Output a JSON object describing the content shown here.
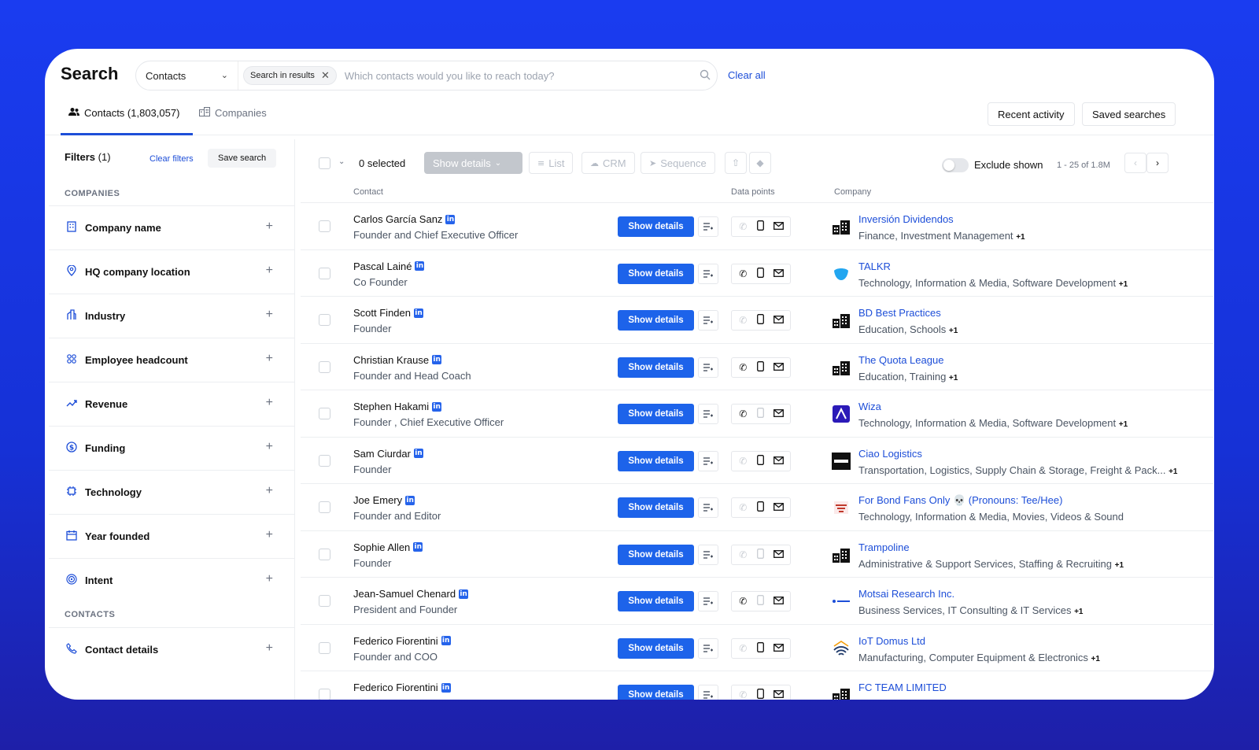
{
  "header": {
    "title": "Search",
    "scope": "Contacts",
    "chip": "Search in results",
    "search_placeholder": "Which contacts would you like to reach today?",
    "clear_all": "Clear all"
  },
  "tabs": {
    "contacts": "Contacts (1,803,057)",
    "companies": "Companies",
    "recent_activity": "Recent activity",
    "saved_searches": "Saved searches"
  },
  "sidebar": {
    "filters_label": "Filters",
    "filters_count": "(1)",
    "clear_filters": "Clear filters",
    "save_search": "Save search",
    "section_companies": "COMPANIES",
    "section_contacts": "CONTACTS",
    "company_filters": [
      {
        "label": "Company name",
        "icon": "building-icon"
      },
      {
        "label": "HQ company location",
        "icon": "location-pin-icon"
      },
      {
        "label": "Industry",
        "icon": "industry-icon"
      },
      {
        "label": "Employee headcount",
        "icon": "people-icon"
      },
      {
        "label": "Revenue",
        "icon": "trend-up-icon"
      },
      {
        "label": "Funding",
        "icon": "dollar-icon"
      },
      {
        "label": "Technology",
        "icon": "chip-icon"
      },
      {
        "label": "Year founded",
        "icon": "calendar-icon"
      },
      {
        "label": "Intent",
        "icon": "target-icon"
      }
    ],
    "contact_filters": [
      {
        "label": "Contact details",
        "icon": "phone-icon"
      }
    ]
  },
  "toolbar": {
    "selected": "0 selected",
    "show_details": "Show details",
    "list": "List",
    "crm": "CRM",
    "sequence": "Sequence",
    "exclude_shown": "Exclude shown",
    "exclude_shown_on": false,
    "pagination": "1 - 25 of 1.8M"
  },
  "columns": {
    "contact": "Contact",
    "data_points": "Data points",
    "company": "Company"
  },
  "show_details_label": "Show details",
  "rows": [
    {
      "name": "Carlos García Sanz",
      "title": "Founder and Chief Executive Officer",
      "company": "Inversión Dividendos",
      "industry": "Finance, Investment Management",
      "more": "+1",
      "phone": "off",
      "mobile": "on",
      "email": "on",
      "logo": "building"
    },
    {
      "name": "Pascal Lainé",
      "title": "Co Founder",
      "company": "TALKR",
      "industry": "Technology, Information & Media, Software Development",
      "more": "+1",
      "phone": "on",
      "mobile": "on",
      "email": "on",
      "logo": "talkr"
    },
    {
      "name": "Scott Finden",
      "title": "Founder",
      "company": "BD Best Practices",
      "industry": "Education, Schools",
      "more": "+1",
      "phone": "off",
      "mobile": "on",
      "email": "on",
      "logo": "building"
    },
    {
      "name": "Christian Krause",
      "title": "Founder and Head Coach",
      "company": "The Quota League",
      "industry": "Education, Training",
      "more": "+1",
      "phone": "on",
      "mobile": "on",
      "email": "on",
      "logo": "building"
    },
    {
      "name": "Stephen Hakami",
      "title": "Founder , Chief Executive Officer",
      "company": "Wiza",
      "industry": "Technology, Information & Media, Software Development",
      "more": "+1",
      "phone": "on",
      "mobile": "off",
      "email": "on",
      "logo": "wiza"
    },
    {
      "name": "Sam Ciurdar",
      "title": "Founder",
      "company": "Ciao Logistics",
      "industry": "Transportation, Logistics, Supply Chain & Storage, Freight & Pack...",
      "more": "+1",
      "phone": "off",
      "mobile": "on",
      "email": "on",
      "logo": "ciao"
    },
    {
      "name": "Joe Emery",
      "title": "Founder and Editor",
      "company": "For Bond Fans Only 💀 (Pronouns: Tee/Hee)",
      "industry": "Technology, Information & Media, Movies, Videos & Sound",
      "more": "",
      "phone": "off",
      "mobile": "on",
      "email": "on",
      "logo": "bond"
    },
    {
      "name": "Sophie Allen",
      "title": "Founder",
      "company": "Trampoline",
      "industry": "Administrative & Support Services, Staffing & Recruiting",
      "more": "+1",
      "phone": "off",
      "mobile": "off",
      "email": "on",
      "logo": "building"
    },
    {
      "name": "Jean-Samuel Chenard",
      "title": "President and Founder",
      "company": "Motsai Research Inc.",
      "industry": "Business Services, IT Consulting & IT Services",
      "more": "+1",
      "phone": "on",
      "mobile": "off",
      "email": "on",
      "logo": "motsai"
    },
    {
      "name": "Federico Fiorentini",
      "title": "Founder and COO",
      "company": "IoT Domus Ltd",
      "industry": "Manufacturing, Computer Equipment & Electronics",
      "more": "+1",
      "phone": "off",
      "mobile": "on",
      "email": "on",
      "logo": "iot"
    },
    {
      "name": "Federico Fiorentini",
      "title": "",
      "company": "FC TEAM LIMITED",
      "industry": "",
      "more": "",
      "phone": "off",
      "mobile": "on",
      "email": "on",
      "logo": "building"
    }
  ],
  "colors": {
    "accent": "#1d63ea",
    "link": "#1d4ed8",
    "background": "#1a3cf0"
  }
}
